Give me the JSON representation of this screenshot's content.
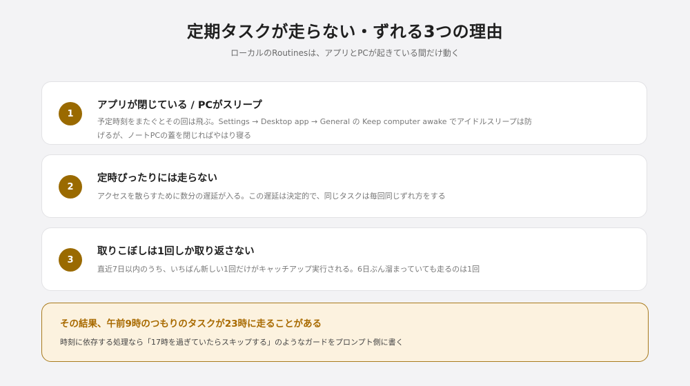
{
  "header": {
    "title": "定期タスクが走らない・ずれる3つの理由",
    "subtitle": "ローカルのRoutinesは、アプリとPCが起きている間だけ動く"
  },
  "reasons": [
    {
      "number": "1",
      "title": "アプリが閉じている / PCがスリープ",
      "body": "予定時刻をまたぐとその回は飛ぶ。Settings → Desktop app → General の Keep computer awake でアイドルスリープは防げるが、ノートPCの蓋を閉じればやはり寝る"
    },
    {
      "number": "2",
      "title": "定時ぴったりには走らない",
      "body": "アクセスを散らすために数分の遅延が入る。この遅延は決定的で、同じタスクは毎回同じずれ方をする"
    },
    {
      "number": "3",
      "title": "取りこぼしは1回しか取り返さない",
      "body": "直近7日以内のうち、いちばん新しい1回だけがキャッチアップ実行される。6日ぶん溜まっていても走るのは1回"
    }
  ],
  "callout": {
    "title": "その結果、午前9時のつもりのタスクが23時に走ることがある",
    "body": "時刻に依存する処理なら「17時を過ぎていたらスキップする」のようなガードをプロンプト側に書く"
  },
  "colors": {
    "accent": "#9a6a00",
    "callout_bg": "#fcf2df",
    "callout_border": "#a87a1c"
  }
}
